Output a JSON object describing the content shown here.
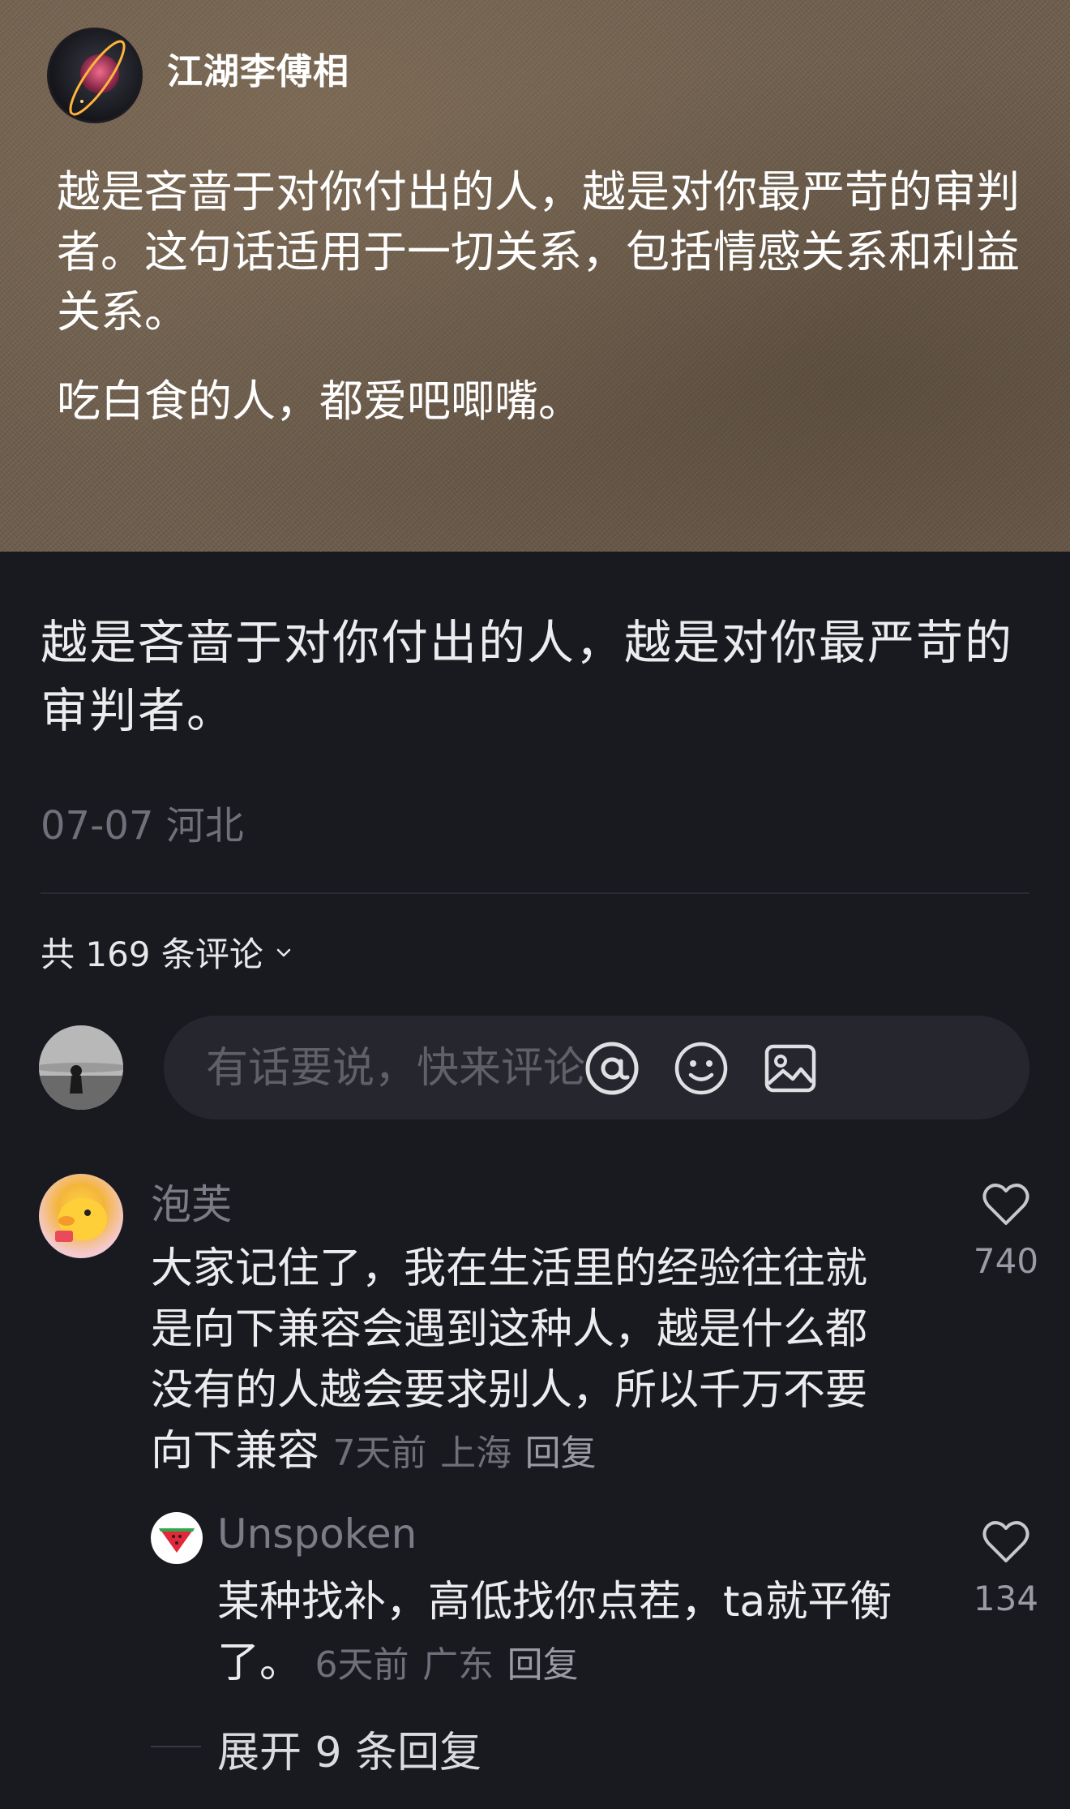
{
  "card": {
    "author": "江湖李傅相",
    "paragraphs": [
      "越是吝啬于对你付出的人，越是对你最严苛的审判者。这句话适用于一切关系，包括情感关系和利益关系。",
      "吃白食的人，都爱吧唧嘴。"
    ]
  },
  "post": {
    "text": "越是吝啬于对你付出的人，越是对你最严苛的审判者。",
    "date": "07-07",
    "location": "河北"
  },
  "comments_header": {
    "label": "共 169 条评论",
    "icon": "chevron-down-icon"
  },
  "input": {
    "placeholder": "有话要说，快来评论",
    "icons": [
      "at-icon",
      "emoji-icon",
      "image-icon"
    ]
  },
  "comments": [
    {
      "author": "泡芙",
      "text": "大家记住了，我在生活里的经验往往就是向下兼容会遇到这种人，越是什么都没有的人越会要求别人，所以千万不要向下兼容",
      "time": "7天前",
      "location": "上海",
      "reply_label": "回复",
      "likes": "740",
      "replies": [
        {
          "author": "Unspoken",
          "text": "某种找补，高低找你点茬，ta就平衡了。",
          "time": "6天前",
          "location": "广东",
          "reply_label": "回复",
          "likes": "134"
        }
      ],
      "expand_label": "展开 9 条回复"
    }
  ],
  "colors": {
    "background": "#191a20",
    "card": "#6e5e4d",
    "muted": "#6f707a",
    "input_bg": "#26272e"
  }
}
